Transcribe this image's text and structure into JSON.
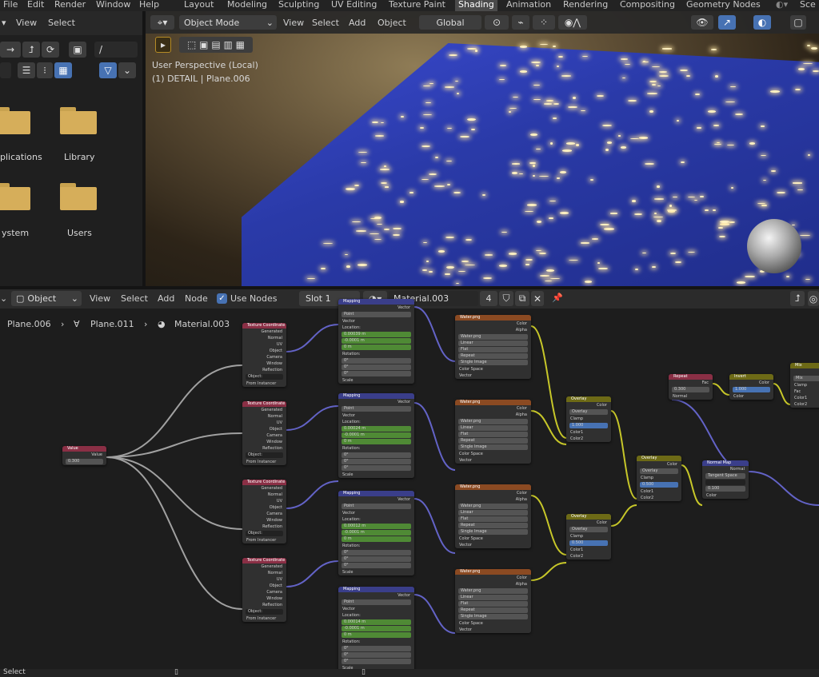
{
  "topbar": {
    "menus": [
      "File",
      "Edit",
      "Render",
      "Window",
      "Help"
    ],
    "workspaces": [
      "Layout",
      "Modeling",
      "Sculpting",
      "UV Editing",
      "Texture Paint",
      "Shading",
      "Animation",
      "Rendering",
      "Compositing",
      "Geometry Nodes"
    ],
    "active_workspace": "Shading",
    "scene_label": "Sce"
  },
  "file_browser": {
    "menus": [
      "View",
      "Select"
    ],
    "path_value": "/",
    "folders": [
      {
        "label": "plications"
      },
      {
        "label": "Library"
      },
      {
        "label": "ystem"
      },
      {
        "label": "Users"
      }
    ],
    "icons": [
      "arrow-right-icon",
      "parent-dir-icon",
      "refresh-icon",
      "new-folder-icon",
      "list-view-icon",
      "thumbnail-view-icon",
      "filter-icon"
    ]
  },
  "viewport": {
    "mode": "Object Mode",
    "menus": [
      "View",
      "Select",
      "Add",
      "Object"
    ],
    "orientation": "Global",
    "overlay_line1": "User Perspective (Local)",
    "overlay_line2": "(1) DETAIL | Plane.006"
  },
  "node_editor": {
    "editor_type": "Object",
    "menus": [
      "View",
      "Select",
      "Add",
      "Node"
    ],
    "use_nodes_label": "Use Nodes",
    "use_nodes_checked": true,
    "slot": "Slot 1",
    "material": "Material.003",
    "user_count": "4",
    "breadcrumb": [
      "Plane.006",
      "Plane.011",
      "Material.003"
    ]
  },
  "nodes": {
    "tex_coord": {
      "title": "Texture Coordinate",
      "outputs": [
        "Generated",
        "Normal",
        "UV",
        "Object",
        "Camera",
        "Window",
        "Reflection"
      ],
      "object_label": "Object:",
      "from_instancer": "From Instancer"
    },
    "mapping": {
      "title": "Mapping",
      "out": "Vector",
      "type_label": "Type:",
      "type_value": "Point",
      "vector_label": "Vector",
      "location_label": "Location:",
      "rotation_label": "Rotation:",
      "scale_label": "Scale",
      "rows": [
        {
          "loc": [
            "0.00039 m",
            "-0.0001 m",
            "0 m"
          ]
        },
        {
          "loc": [
            "0.00024 m",
            "-0.0001 m",
            "0 m"
          ]
        },
        {
          "loc": [
            "0.00012 m",
            "-0.0001 m",
            "0 m"
          ]
        },
        {
          "loc": [
            "0.00014 m",
            "-0.0001 m",
            "0 m"
          ]
        }
      ],
      "rot": [
        "0°",
        "0°",
        "0°"
      ]
    },
    "image": {
      "title": "Water.png",
      "outputs": [
        "Color",
        "Alpha"
      ],
      "file": "Water.png",
      "users": "4",
      "interp": "Linear",
      "proj": "Flat",
      "ext": "Repeat",
      "src": "Single Image",
      "cs_label": "Color Space",
      "cs_value": "Non-Color",
      "vector": "Vector"
    },
    "overlay": {
      "title": "Overlay",
      "color": "Color",
      "mode": "Overlay",
      "clamp": "Clamp",
      "fac_label": "Fac",
      "fac_values": [
        "1.000",
        "0.500",
        "0.500"
      ],
      "inputs": [
        "Color1",
        "Color2"
      ]
    },
    "value": {
      "title": "Value",
      "out": "Value",
      "val": "0.300"
    },
    "repeat": {
      "title": "Repeat",
      "fac": "Fac",
      "ior": "IOR",
      "ior_val": "0.300",
      "normal": "Normal"
    },
    "invert": {
      "title": "Invert",
      "color": "Color",
      "fac": "Fac",
      "fac_val": "1.000"
    },
    "mix": {
      "title": "Mix",
      "color": "Color",
      "mode": "Mix",
      "clamp": "Clamp",
      "fac": "Fac",
      "c1": "Color1",
      "c2": "Color2"
    },
    "normal_map": {
      "title": "Normal Map",
      "normal": "Normal",
      "space": "Tangent Space",
      "strength_label": "Strength",
      "strength": "0.100",
      "color": "Color"
    }
  },
  "status": {
    "left": "Select"
  },
  "colors": {
    "accent": "#4772b3",
    "tex_header": "#8a2f45",
    "vec_header": "#3a3e8a",
    "img_header": "#8b4a22",
    "color_header": "#6d6a16",
    "link_vector": "#6363c7",
    "link_color": "#c7c729",
    "link_float": "#a1a1a1"
  }
}
